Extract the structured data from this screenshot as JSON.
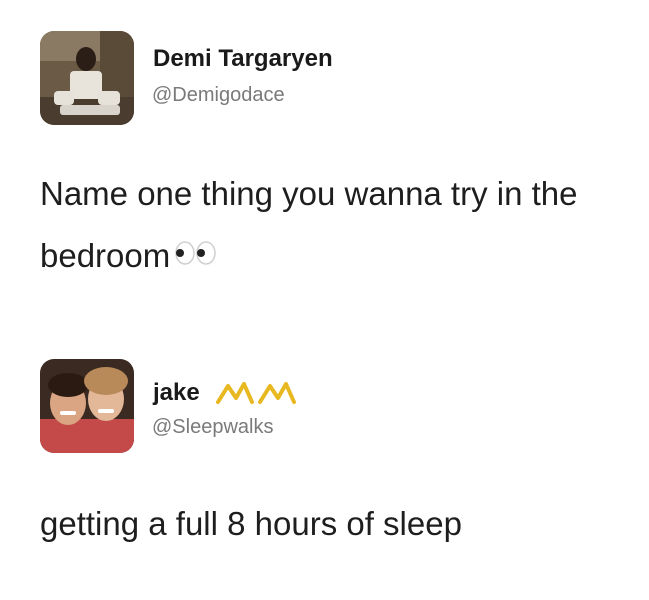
{
  "tweets": [
    {
      "display_name": "Demi Targaryen",
      "handle": "@Demigodace",
      "text": "Name one thing you wanna try in the bedroom",
      "emoji": "eyes-icon"
    },
    {
      "display_name": "jake",
      "handle": "@Sleepwalks",
      "text": "getting a full 8 hours of sleep",
      "name_decoration": "crown-icon"
    }
  ],
  "colors": {
    "name": "#1a1a1a",
    "handle": "#7a7a7a",
    "text": "#1e1e1e",
    "decoration": "#e8b820"
  }
}
